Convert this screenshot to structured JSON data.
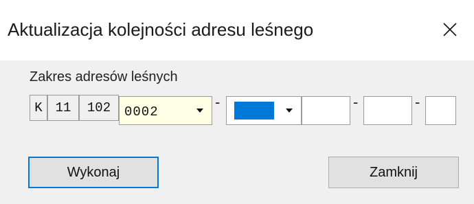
{
  "window": {
    "title": "Aktualizacja kolejności adresu leśnego",
    "close_icon": "close-icon"
  },
  "range_group": {
    "label": "Zakres adresów leśnych",
    "segments": [
      "K",
      "11",
      "102"
    ],
    "combo_value": "0002",
    "separator": "-"
  },
  "buttons": {
    "execute": "Wykonaj",
    "close": "Zamknij"
  },
  "colors": {
    "accent": "#0078d7",
    "combo_background": "#ffffe6",
    "dialog_background": "#f0f0f0"
  }
}
